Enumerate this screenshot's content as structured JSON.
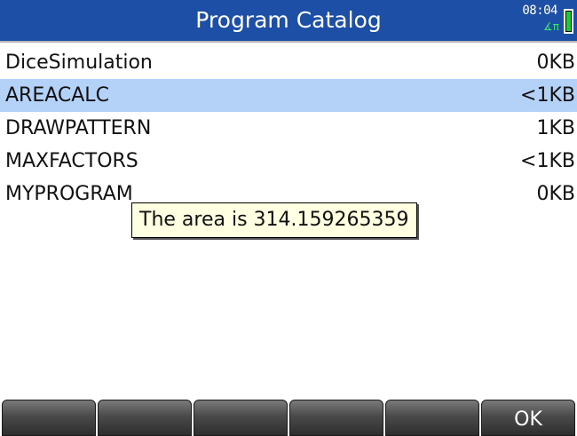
{
  "header": {
    "title": "Program Catalog",
    "time": "08:04",
    "angle_mode": "∡π",
    "battery_icon": "battery-icon"
  },
  "programs": [
    {
      "name": "DiceSimulation",
      "size": "0KB",
      "selected": false
    },
    {
      "name": "AREACALC",
      "size": "<1KB",
      "selected": true
    },
    {
      "name": "DRAWPATTERN",
      "size": "1KB",
      "selected": false
    },
    {
      "name": "MAXFACTORS",
      "size": "<1KB",
      "selected": false
    },
    {
      "name": "MYPROGRAM",
      "size": "0KB",
      "selected": false
    }
  ],
  "popup": {
    "message": "The area is 314.159265359"
  },
  "softkeys": [
    "",
    "",
    "",
    "",
    "",
    "OK"
  ],
  "colors": {
    "titlebar": "#1d4fa7",
    "selected_row": "#b4d1f7",
    "popup_bg": "#ffffe1"
  }
}
